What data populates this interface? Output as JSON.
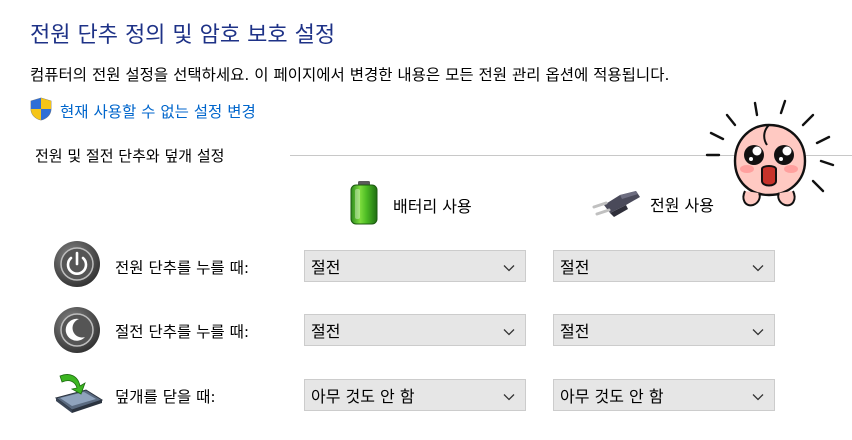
{
  "page": {
    "title": "전원 단추 정의 및 암호 보호 설정",
    "description": "컴퓨터의 전원 설정을 선택하세요. 이 페이지에서 변경한 내용은 모든 전원 관리 옵션에 적용됩니다.",
    "admin_link": "현재 사용할 수 없는 설정 변경"
  },
  "section": {
    "header": "전원 및 절전 단추와 덮개 설정"
  },
  "columns": {
    "battery": "배터리 사용",
    "plugged": "전원 사용"
  },
  "rows": [
    {
      "label": "전원 단추를 누를 때:",
      "icon": "power-button-icon",
      "battery_value": "절전",
      "plugged_value": "절전"
    },
    {
      "label": "절전 단추를 누를 때:",
      "icon": "sleep-button-icon",
      "battery_value": "절전",
      "plugged_value": "절전"
    },
    {
      "label": "덮개를 닫을 때:",
      "icon": "laptop-lid-icon",
      "battery_value": "아무 것도 안 함",
      "plugged_value": "아무 것도 안 함"
    }
  ],
  "colors": {
    "title": "#1e3287",
    "link": "#0066cc",
    "select_bg": "#e6e6e6"
  }
}
